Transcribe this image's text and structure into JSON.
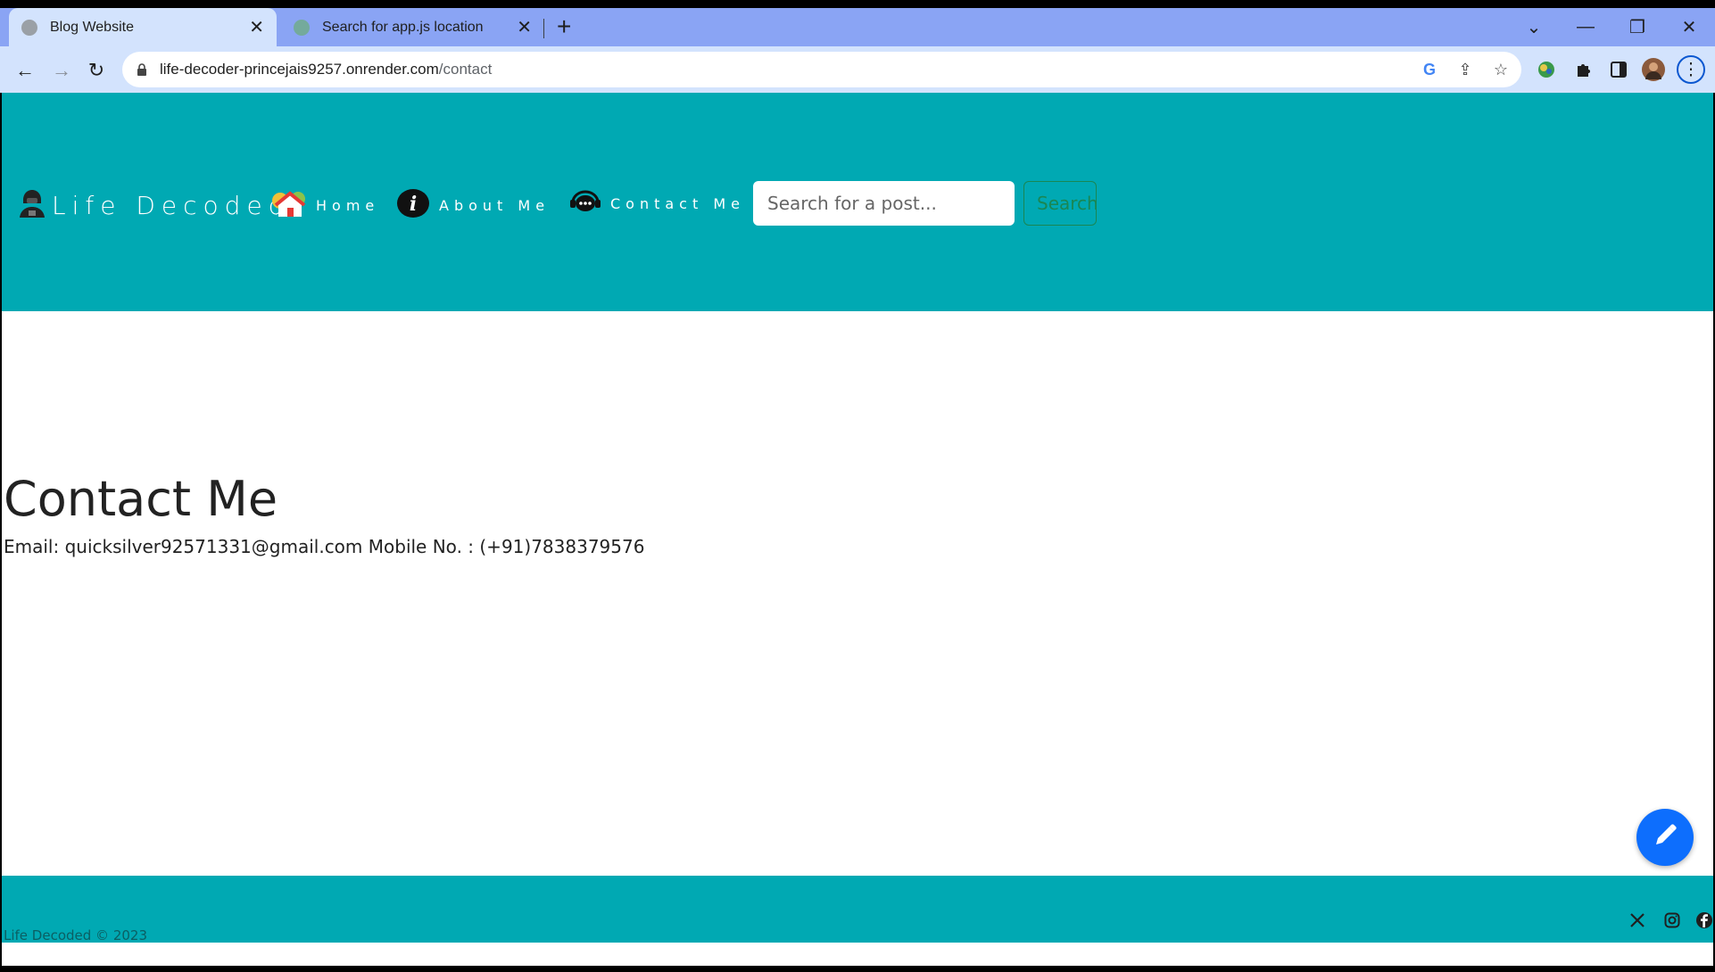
{
  "browser": {
    "tabs": [
      {
        "title": "Blog Website",
        "active": true
      },
      {
        "title": "Search for app.js location",
        "active": false
      }
    ],
    "url_host": "life-decoder-princejais9257.onrender.com",
    "url_path": "/contact"
  },
  "nav": {
    "brand": "Life Decoded",
    "links": [
      {
        "label": "Home"
      },
      {
        "label": "About Me"
      },
      {
        "label": "Contact Me"
      }
    ],
    "search_placeholder": "Search for a post...",
    "search_button": "Search"
  },
  "main": {
    "title": "Contact Me",
    "info": "Email: quicksilver92571331@gmail.com Mobile No. : (+91)7838379576"
  },
  "footer": {
    "copyright": "Life Decoded © 2023",
    "social_icons": [
      "x-icon",
      "instagram-icon",
      "facebook-icon"
    ]
  },
  "colors": {
    "primary": "#00a9b3",
    "fab": "#0d6efd",
    "search_border": "#198754"
  }
}
